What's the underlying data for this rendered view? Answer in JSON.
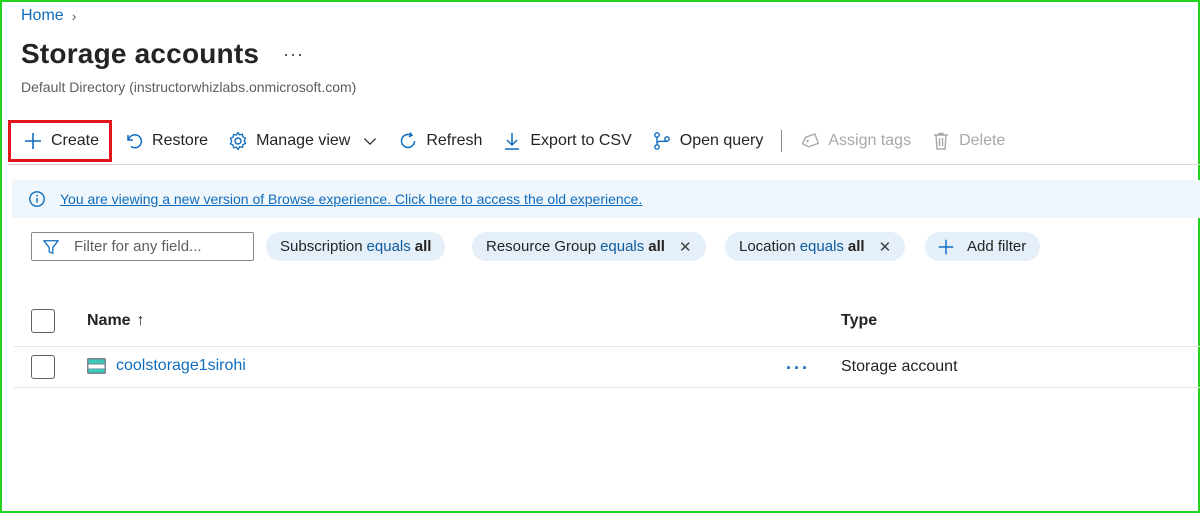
{
  "breadcrumb": {
    "home": "Home",
    "separator": "›"
  },
  "page": {
    "title": "Storage accounts",
    "more": "···",
    "subtitle": "Default Directory (instructorwhizlabs.onmicrosoft.com)"
  },
  "toolbar": {
    "create": "Create",
    "restore": "Restore",
    "manage_view": "Manage view",
    "refresh": "Refresh",
    "export_csv": "Export to CSV",
    "open_query": "Open query",
    "assign_tags": "Assign tags",
    "delete": "Delete"
  },
  "banner": {
    "text": "You are viewing a new version of Browse experience. Click here to access the old experience."
  },
  "filters": {
    "placeholder": "Filter for any field...",
    "pills": [
      {
        "field": "Subscription",
        "op": "equals",
        "value": "all",
        "removable": false
      },
      {
        "field": "Resource Group",
        "op": "equals",
        "value": "all",
        "removable": true
      },
      {
        "field": "Location",
        "op": "equals",
        "value": "all",
        "removable": true
      }
    ],
    "add_filter": "Add filter",
    "remove_glyph": "✕"
  },
  "table": {
    "columns": {
      "name": "Name",
      "sort_indicator": "↑",
      "type": "Type"
    },
    "rows": [
      {
        "name": "coolstorage1sirohi",
        "more": "···",
        "type": "Storage account"
      }
    ]
  },
  "colors": {
    "accent": "#0f6cbd",
    "highlight_border": "#e3131b",
    "frame_border": "#22d31f"
  },
  "icons": [
    "chevron-right-icon",
    "plus-icon",
    "undo-icon",
    "gear-icon",
    "chevron-down-icon",
    "refresh-icon",
    "download-icon",
    "query-icon",
    "tag-icon",
    "trash-icon",
    "info-icon",
    "funnel-icon",
    "close-icon",
    "storage-account-icon"
  ]
}
